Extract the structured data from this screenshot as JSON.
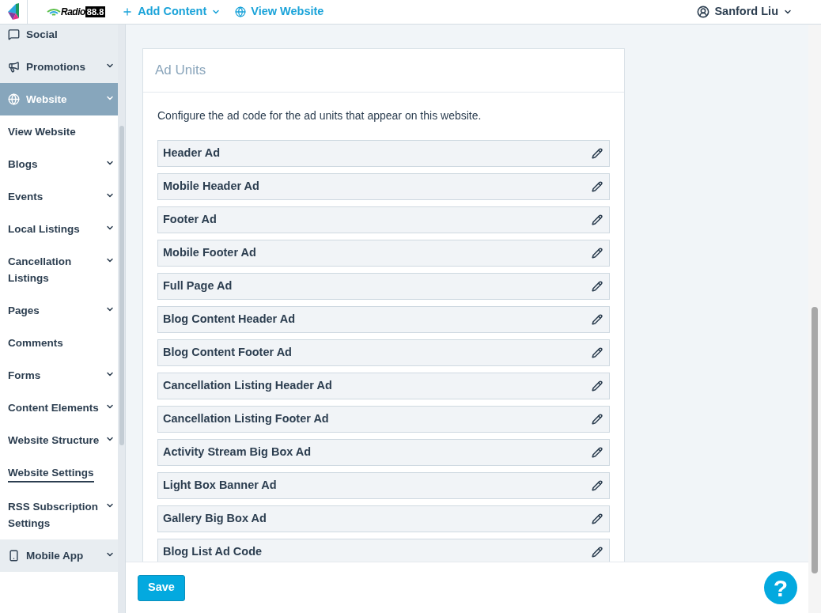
{
  "header": {
    "brand_name": "Radio",
    "brand_number": "88.8",
    "nav": [
      {
        "label": "Add Content",
        "dropdown": true
      },
      {
        "label": "View Website",
        "dropdown": false
      }
    ],
    "user": {
      "name": "Sanford Liu"
    }
  },
  "sidebar": {
    "items": [
      {
        "label": "Social",
        "kind": "section",
        "expandable": false,
        "selected": false
      },
      {
        "label": "Promotions",
        "kind": "section",
        "expandable": true,
        "selected": false
      },
      {
        "label": "Website",
        "kind": "section",
        "expandable": true,
        "selected": true
      },
      {
        "label": "View Website",
        "kind": "sub",
        "expandable": false,
        "selected": false
      },
      {
        "label": "Blogs",
        "kind": "sub",
        "expandable": true,
        "selected": false
      },
      {
        "label": "Events",
        "kind": "sub",
        "expandable": true,
        "selected": false
      },
      {
        "label": "Local Listings",
        "kind": "sub",
        "expandable": true,
        "selected": false
      },
      {
        "label": "Cancellation Listings",
        "kind": "sub",
        "expandable": true,
        "selected": false
      },
      {
        "label": "Pages",
        "kind": "sub",
        "expandable": true,
        "selected": false
      },
      {
        "label": "Comments",
        "kind": "sub",
        "expandable": false,
        "selected": false
      },
      {
        "label": "Forms",
        "kind": "sub",
        "expandable": true,
        "selected": false
      },
      {
        "label": "Content Elements",
        "kind": "sub",
        "expandable": true,
        "selected": false
      },
      {
        "label": "Website Structure",
        "kind": "sub",
        "expandable": true,
        "selected": false
      },
      {
        "label": "Website Settings",
        "kind": "sub",
        "expandable": false,
        "selected": true
      },
      {
        "label": "RSS Subscription Settings",
        "kind": "sub",
        "expandable": true,
        "selected": false
      },
      {
        "label": "Mobile App",
        "kind": "section",
        "expandable": true,
        "selected": false
      }
    ]
  },
  "card": {
    "title": "Ad Units",
    "description": "Configure the ad code for the ad units that appear on this website.",
    "ad_units": [
      "Header Ad",
      "Mobile Header Ad",
      "Footer Ad",
      "Mobile Footer Ad",
      "Full Page Ad",
      "Blog Content Header Ad",
      "Blog Content Footer Ad",
      "Cancellation Listing Header Ad",
      "Cancellation Listing Footer Ad",
      "Activity Stream Big Box Ad",
      "Light Box Banner Ad",
      "Gallery Big Box Ad",
      "Blog List Ad Code"
    ]
  },
  "footer": {
    "save": "Save",
    "help": "?"
  }
}
